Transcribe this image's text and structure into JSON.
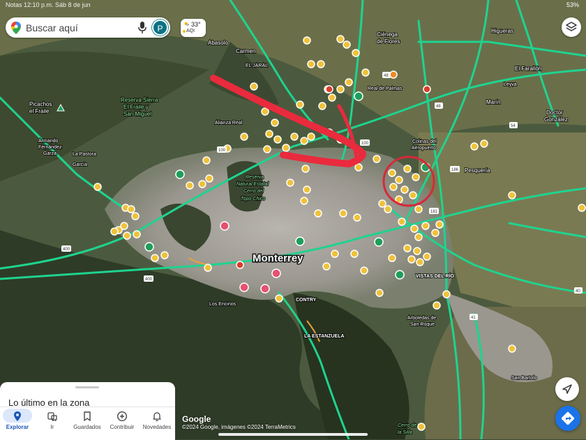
{
  "status_bar": {
    "left": "Notas  12:10 p.m.  Sáb 8 de jun",
    "right": "53%"
  },
  "search": {
    "placeholder": "Buscar aquí",
    "avatar_letter": "P"
  },
  "weather": {
    "temp": "33°",
    "aqi": "AQI"
  },
  "map": {
    "city": "Monterrey",
    "labels": [
      {
        "text": "Abasolo",
        "type": "place"
      },
      {
        "text": "Carmen",
        "type": "place"
      },
      {
        "text": "EL JARAL",
        "type": "place"
      },
      {
        "text": "Ciénega",
        "type": "place"
      },
      {
        "text": "de Flores",
        "type": "place"
      },
      {
        "text": "Higueras",
        "type": "place"
      },
      {
        "text": "El Fara­llón",
        "type": "place"
      },
      {
        "text": "Leyva",
        "type": "place"
      },
      {
        "text": "Marín",
        "type": "place"
      },
      {
        "text": "Doctor",
        "type": "place"
      },
      {
        "text": "González",
        "type": "place"
      },
      {
        "text": "Real de Palmas",
        "type": "place"
      },
      {
        "text": "Picachos",
        "type": "park"
      },
      {
        "text": "el Fraile",
        "type": "park"
      },
      {
        "text": "Reserva Sierra",
        "type": "park"
      },
      {
        "text": "El Fraile y",
        "type": "park"
      },
      {
        "text": "San Miguel",
        "type": "park"
      },
      {
        "text": "Armando",
        "type": "place"
      },
      {
        "text": "Fernández",
        "type": "place"
      },
      {
        "text": "Garza",
        "type": "place"
      },
      {
        "text": "La Pastora",
        "type": "place"
      },
      {
        "text": "García",
        "type": "place"
      },
      {
        "text": "Alianza Real",
        "type": "place"
      },
      {
        "text": "Colinas del",
        "type": "place"
      },
      {
        "text": "Aeropuerto",
        "type": "place"
      },
      {
        "text": "Pesquería",
        "type": "place"
      },
      {
        "text": "Reserva",
        "type": "park"
      },
      {
        "text": "Natural Estatal",
        "type": "park"
      },
      {
        "text": "Cerro del",
        "type": "park"
      },
      {
        "text": "Topo Chico",
        "type": "park"
      },
      {
        "text": "VISTAS DEL RÍO",
        "type": "place"
      },
      {
        "text": "Arboledas de",
        "type": "place"
      },
      {
        "text": "San Roque",
        "type": "place"
      },
      {
        "text": "Los Encinos",
        "type": "place"
      },
      {
        "text": "CONTRY",
        "type": "place"
      },
      {
        "text": "LA ESTANZUELA",
        "type": "place"
      },
      {
        "text": "San Bartolo",
        "type": "place"
      },
      {
        "text": "Cerro de",
        "type": "park"
      },
      {
        "text": "la Silla",
        "type": "park"
      }
    ],
    "road_shields": [
      "100",
      "100",
      "48",
      "186",
      "181",
      "400",
      "400",
      "40",
      "41",
      "54",
      "48"
    ]
  },
  "bottom_sheet": {
    "title": "Lo último en la zona"
  },
  "bottom_nav": [
    {
      "label": "Explorar",
      "active": true
    },
    {
      "label": "Ir",
      "active": false
    },
    {
      "label": "Guardados",
      "active": false
    },
    {
      "label": "Contribuir",
      "active": false
    },
    {
      "label": "Novedades",
      "active": false
    }
  ],
  "attribution": {
    "logo": "Google",
    "text": "©2024 Google, imágenes ©2024 TerraMetrics"
  },
  "colors": {
    "road": "#1fd38f",
    "poi": "#f0c23a",
    "annotation": "#ea2a3d",
    "accent": "#1a73e8"
  }
}
